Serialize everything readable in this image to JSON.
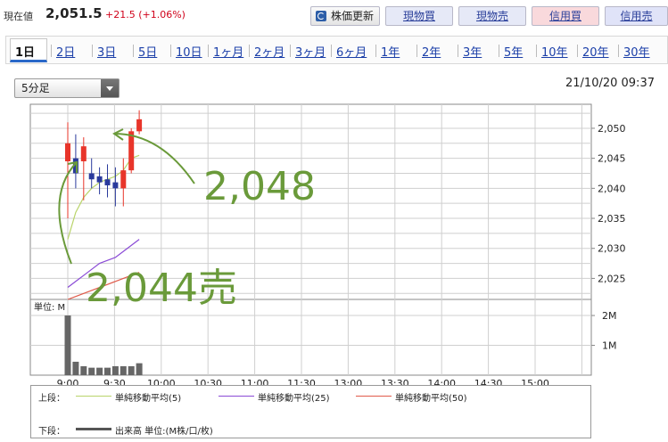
{
  "header": {
    "price_label": "現在値",
    "price_value": "2,051.5",
    "price_change": "+21.5 (+1.06%)",
    "buttons": {
      "update": "株価更新",
      "cash_buy": "現物買",
      "cash_sell": "現物売",
      "margin_buy": "信用買",
      "margin_sell": "信用売"
    }
  },
  "tabs": [
    "1日",
    "2日",
    "3日",
    "5日",
    "10日",
    "1ヶ月",
    "2ヶ月",
    "3ヶ月",
    "6ヶ月",
    "1年",
    "2年",
    "3年",
    "5年",
    "10年",
    "20年",
    "30年"
  ],
  "active_tab": "1日",
  "interval_select": {
    "value": "5分足"
  },
  "timestamp": "21/10/20 09:37",
  "annotations": {
    "upper": "2,048",
    "lower": "2,044売",
    "color": "#6a9a3a"
  },
  "colors": {
    "up": "#e8352a",
    "down": "#2a3a9c",
    "ma5": "#b9d46a",
    "ma25": "#8a4ad6",
    "ma50": "#e05a4a",
    "volume": "#666666"
  },
  "legend": {
    "upper_label": "上段：",
    "ma5": "単純移動平均(5)",
    "ma25": "単純移動平均(25)",
    "ma50": "単純移動平均(50)",
    "lower_label": "下段：",
    "volume": "出来高 単位:(M株/口/枚)"
  },
  "chart_data": {
    "type": "candlestick",
    "x_ticks": [
      "9:00",
      "9:30",
      "10:00",
      "10:30",
      "11:00",
      "11:30",
      "13:00",
      "13:30",
      "14:00",
      "14:30",
      "15:00"
    ],
    "price_axis": {
      "ticks": [
        "2,025",
        "2,030",
        "2,035",
        "2,040",
        "2,045",
        "2,050"
      ],
      "ylim": [
        2021.5,
        2054
      ]
    },
    "volume_axis": {
      "unit_label": "単位: M",
      "ticks": [
        "1M",
        "2M"
      ],
      "ylim": [
        0,
        2.3
      ]
    },
    "candles": [
      {
        "o": 2044.5,
        "h": 2051,
        "l": 2035,
        "c": 2047.5
      },
      {
        "o": 2045,
        "h": 2049,
        "l": 2040,
        "c": 2042.5
      },
      {
        "o": 2044.5,
        "h": 2048.5,
        "l": 2038,
        "c": 2047
      },
      {
        "o": 2042.5,
        "h": 2045,
        "l": 2040,
        "c": 2041.5
      },
      {
        "o": 2042,
        "h": 2043.5,
        "l": 2039,
        "c": 2041
      },
      {
        "o": 2041.5,
        "h": 2044,
        "l": 2038.5,
        "c": 2040.5
      },
      {
        "o": 2041,
        "h": 2043.5,
        "l": 2037,
        "c": 2040
      },
      {
        "o": 2040,
        "h": 2045,
        "l": 2037,
        "c": 2043
      },
      {
        "o": 2043,
        "h": 2050,
        "l": 2042.5,
        "c": 2049.5
      },
      {
        "o": 2049.5,
        "h": 2053,
        "l": 2049,
        "c": 2051.5
      }
    ],
    "ma5": [
      2031.5,
      2036,
      2038.5,
      2040,
      2041,
      2041.5,
      2042,
      2043,
      2045,
      2045.5
    ],
    "ma25": [
      2023.5,
      2024.5,
      2025.5,
      2026.5,
      2027.5,
      2028,
      2028.5,
      2029.5,
      2030.5,
      2031.5
    ],
    "ma50": [
      2021.5,
      2022,
      2022.5,
      2023,
      2023.5,
      2024,
      2024.5,
      2025,
      2025.5,
      2026
    ],
    "volume": [
      2.0,
      0.45,
      0.3,
      0.25,
      0.25,
      0.25,
      0.3,
      0.3,
      0.3,
      0.4
    ]
  }
}
